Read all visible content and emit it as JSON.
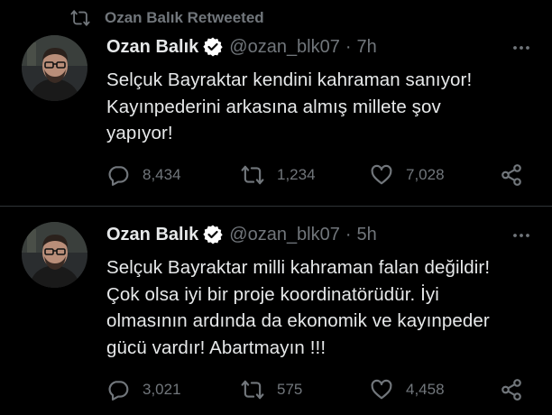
{
  "colors": {
    "background": "#000000",
    "text": "#e7e9ea",
    "muted": "#71767b",
    "divider": "#2f3336",
    "verified": "#ffffff"
  },
  "tweets": [
    {
      "retweeted_by": "Ozan Balık Retweeted",
      "author": {
        "name": "Ozan Balık",
        "handle": "@ozan_blk07",
        "verified_icon": "verified-badge-icon"
      },
      "separator": "·",
      "time": "7h",
      "text": "Selçuk Bayraktar kendini kahraman sanıyor!\nKayınpederini arkasına almış millete şov\nyapıyor!",
      "stats": {
        "replies": "8,434",
        "retweets": "1,234",
        "likes": "7,028"
      }
    },
    {
      "author": {
        "name": "Ozan Balık",
        "handle": "@ozan_blk07",
        "verified_icon": "verified-badge-icon"
      },
      "separator": "·",
      "time": "5h",
      "text": "Selçuk Bayraktar milli kahraman falan değildir!\nÇok olsa iyi bir proje koordinatörüdür. İyi\nolmasının ardında da ekonomik ve kayınpeder\ngücü vardır! Abartmayın !!!",
      "stats": {
        "replies": "3,021",
        "retweets": "575",
        "likes": "4,458"
      }
    }
  ]
}
